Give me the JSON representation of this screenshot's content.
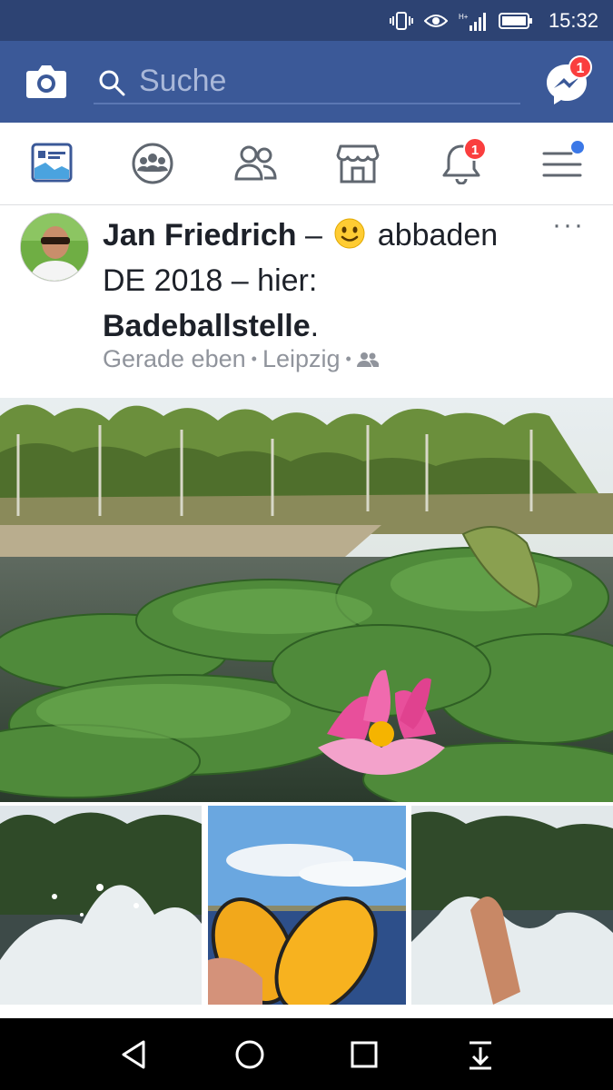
{
  "status_bar": {
    "time": "15:32",
    "icons": [
      "vibrate-icon",
      "eye-icon",
      "signal-icon",
      "battery-icon"
    ]
  },
  "header": {
    "search_placeholder": "Suche",
    "messenger_badge": "1",
    "colors": {
      "brand": "#3b5998",
      "status_bar": "#2d4373",
      "badge": "#fa3e3e"
    }
  },
  "nav": {
    "tabs": [
      {
        "name": "news-feed",
        "icon": "news-feed-icon"
      },
      {
        "name": "groups",
        "icon": "groups-icon"
      },
      {
        "name": "friends",
        "icon": "friends-icon"
      },
      {
        "name": "marketplace",
        "icon": "marketplace-icon"
      },
      {
        "name": "notifications",
        "icon": "bell-icon",
        "badge": "1"
      },
      {
        "name": "menu",
        "icon": "menu-icon"
      }
    ]
  },
  "post": {
    "author": "Jan Friedrich",
    "dash": "–",
    "feeling": "abbaden DE 2018",
    "dash2": "–",
    "at": "hier:",
    "place": "Badeballstelle",
    "period": ".",
    "time": "Gerade eben",
    "separator": "•",
    "location": "Leipzig",
    "separator2": "•",
    "audience_icon": "friends-audience-icon",
    "more_label": "···"
  }
}
